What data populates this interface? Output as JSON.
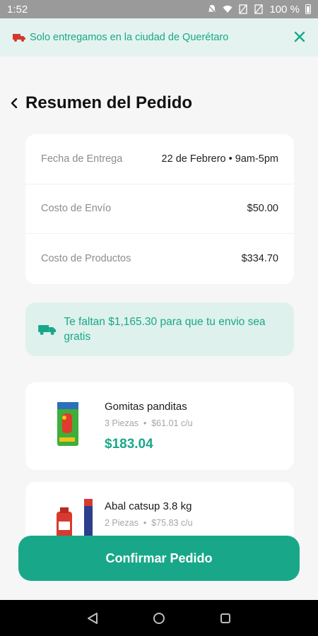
{
  "status_bar": {
    "time": "1:52",
    "battery": "100 %"
  },
  "banner": {
    "text": "Solo entregamos en la ciudad de Querétaro"
  },
  "header": {
    "title": "Resumen del Pedido"
  },
  "summary": [
    {
      "label": "Fecha de Entrega",
      "value": "22 de Febrero • 9am-5pm"
    },
    {
      "label": "Costo de Envío",
      "value": "$50.00"
    },
    {
      "label": "Costo de Productos",
      "value": "$334.70"
    }
  ],
  "free_shipping_notice": {
    "text": "Te faltan $1,165.30 para que tu envio sea gratis"
  },
  "products": [
    {
      "name": "Gomitas panditas",
      "qty": "3 Piezas",
      "unit_price": "$61.01 c/u",
      "total": "$183.04"
    },
    {
      "name": "Abal catsup 3.8 kg",
      "qty": "2 Piezas",
      "unit_price": "$75.83 c/u"
    }
  ],
  "confirm_button": {
    "label": "Confirmar Pedido"
  },
  "colors": {
    "accent": "#18a889",
    "banner_bg": "#e4f3ef",
    "notice_bg": "#dff1ec"
  }
}
